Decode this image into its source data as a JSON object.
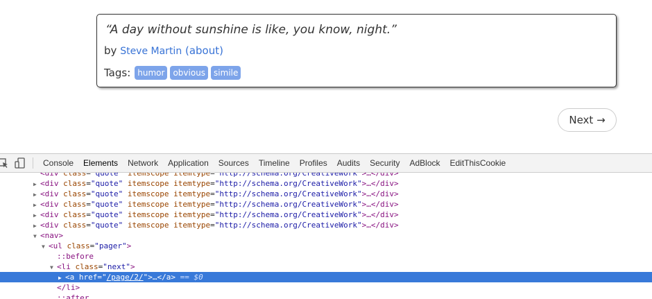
{
  "quote": {
    "text": "“A day without sunshine is like, you know, night.”",
    "by_label": "by",
    "author": "Steve Martin",
    "about": "(about)",
    "tags_label": "Tags:",
    "tags": [
      "humor",
      "obvious",
      "simile"
    ]
  },
  "pager": {
    "next_label": "Next →"
  },
  "devtools": {
    "tabs": [
      "Console",
      "Elements",
      "Network",
      "Application",
      "Sources",
      "Timeline",
      "Profiles",
      "Audits",
      "Security",
      "AdBlock",
      "EditThisCookie"
    ],
    "active_tab": "Elements",
    "dom": {
      "quote_tag": "<div",
      "class_attr": "class",
      "quote_class": "\"quote\"",
      "itemscope": "itemscope",
      "itemtype_attr": "itemtype",
      "itemtype_val": "\"http://schema.org/CreativeWork\"",
      "collapsed_tail": ">…</div>",
      "nav_open": "<nav>",
      "ul_open": "<ul",
      "pager_class": "\"pager\"",
      "before": "::before",
      "li_open": "<li",
      "next_class": "\"next\"",
      "a_open": "<a",
      "href_attr": "href",
      "href_val": "/page/2/",
      "a_tail": "\">…</a>",
      "selected_marker": "== $0",
      "li_close": "</li>",
      "after": "::after"
    }
  }
}
